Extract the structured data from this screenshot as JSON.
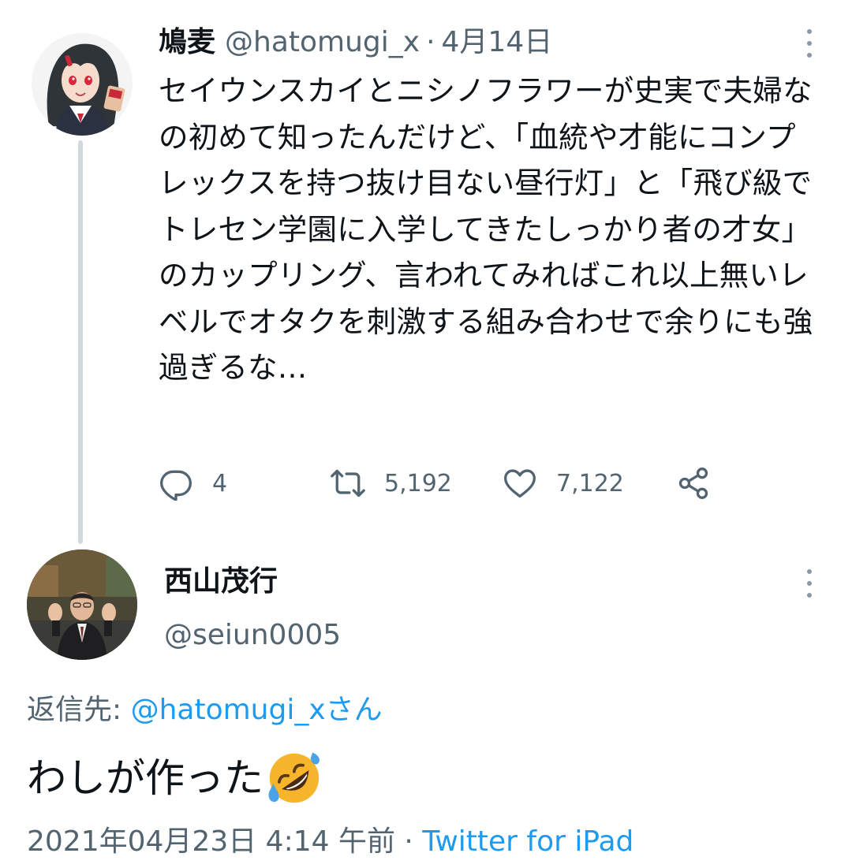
{
  "colors": {
    "text_primary": "#0f1419",
    "text_secondary": "#536471",
    "link": "#1d9bf0",
    "thread_line": "#cfd9de"
  },
  "parent_tweet": {
    "display_name": "鳩麦",
    "handle": "@hatomugi_x",
    "separator": "·",
    "date": "4月14日",
    "text": "セイウンスカイとニシノフラワーが史実で夫婦なの初めて知ったんだけど、「血統や才能にコンプレックスを持つ抜け目ない昼行灯」と「飛び級でトレセン学園に入学してきたしっかり者の才女」のカップリング、言われてみればこれ以上無いレベルでオタクを刺激する組み合わせで余りにも強過ぎるな…",
    "avatar_icon": "anime-girl-avatar",
    "actions": {
      "reply_count": "4",
      "retweet_count": "5,192",
      "like_count": "7,122"
    }
  },
  "reply_tweet": {
    "display_name": "西山茂行",
    "handle": "@seiun0005",
    "avatar_icon": "man-waving-avatar",
    "reply_to_label": "返信先: ",
    "reply_to_handle": "@hatomugi_x",
    "reply_to_suffix": "さん",
    "text": "わしが作った",
    "emoji": "rolling-on-the-floor-laughing-emoji",
    "timestamp": "2021年04月23日 4:14 午前",
    "meta_separator": " · ",
    "source": "Twitter for iPad"
  }
}
